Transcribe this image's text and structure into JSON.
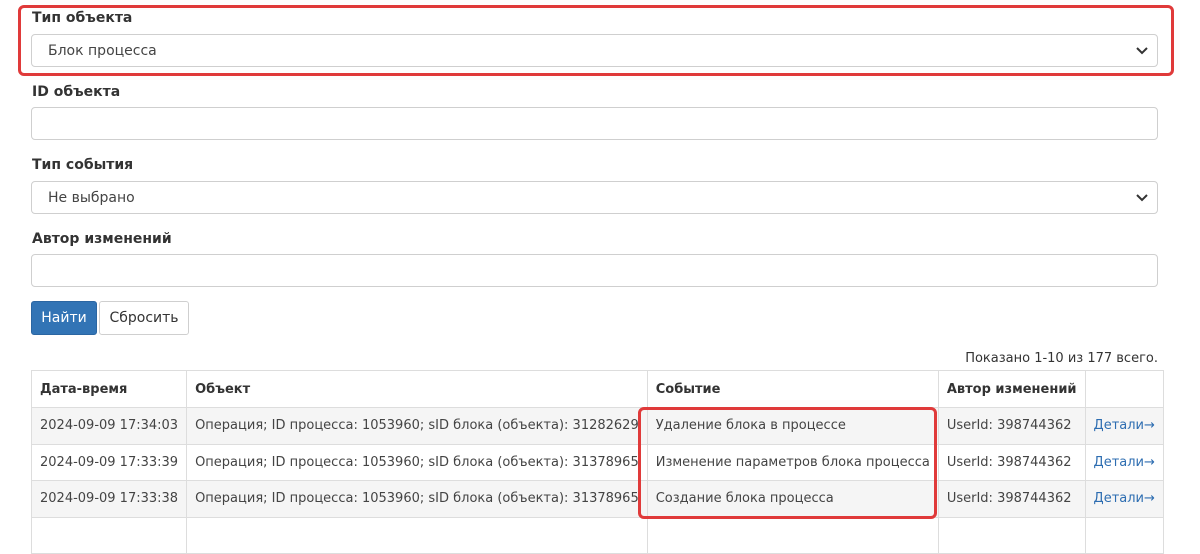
{
  "filters": {
    "object_type": {
      "label": "Тип объекта",
      "value": "Блок процесса"
    },
    "object_id": {
      "label": "ID объекта",
      "value": ""
    },
    "event_type": {
      "label": "Тип события",
      "value": "Не выбрано"
    },
    "author": {
      "label": "Автор изменений",
      "value": ""
    }
  },
  "buttons": {
    "find": "Найти",
    "reset": "Сбросить"
  },
  "summary": "Показано 1-10 из 177 всего.",
  "table": {
    "headers": [
      "Дата-время",
      "Объект",
      "Событие",
      "Автор изменений",
      ""
    ],
    "rows": [
      {
        "datetime": "2024-09-09 17:34:03",
        "object": "Операция; ID процесса: 1053960; sID блока (объекта): 31282629",
        "event": "Удаление блока в процессе",
        "author": "UserId: 398744362",
        "details": "Детали→"
      },
      {
        "datetime": "2024-09-09 17:33:39",
        "object": "Операция; ID процесса: 1053960; sID блока (объекта): 31378965",
        "event": "Изменение параметров блока процесса",
        "author": "UserId: 398744362",
        "details": "Детали→"
      },
      {
        "datetime": "2024-09-09 17:33:38",
        "object": "Операция; ID процесса: 1053960; sID блока (объекта): 31378965",
        "event": "Создание блока процесса",
        "author": "UserId: 398744362",
        "details": "Детали→"
      },
      {
        "datetime": "",
        "object": "",
        "event": "",
        "author": "",
        "details": ""
      }
    ]
  },
  "colors": {
    "highlight": "#e03a3a",
    "primary_button": "#3274b5",
    "link": "#2d6db1"
  }
}
